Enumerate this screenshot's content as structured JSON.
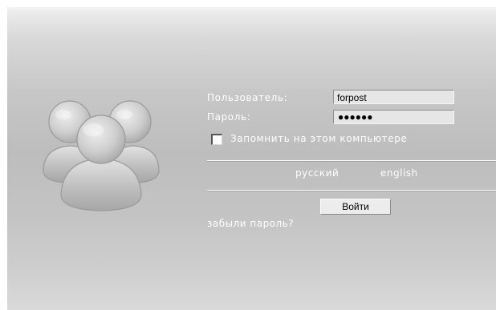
{
  "login": {
    "username_label": "Пользователь:",
    "password_label": "Пароль:",
    "username_value": "forpost",
    "password_masked": "●●●●●●",
    "remember_label": "Запомнить на этом компьютере",
    "remember_checked": false,
    "submit_label": "Войти",
    "forgot_label": "забыли пароль?"
  },
  "languages": {
    "russian": "русский",
    "english": "english"
  },
  "icons": {
    "avatar": "users-group-icon"
  }
}
